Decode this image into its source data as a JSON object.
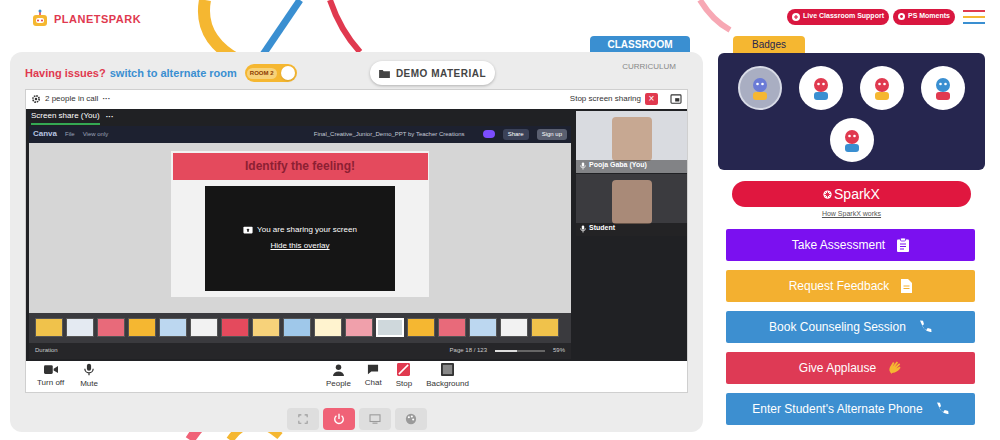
{
  "header": {
    "logo": "PLANETSPARK",
    "buttons": [
      {
        "label": "Live Classroom Support",
        "kind": "support"
      },
      {
        "label": "PS Moments",
        "kind": "moments"
      }
    ]
  },
  "room": {
    "issue": "Having issues?",
    "switch_link": "switch to alternate room",
    "toggle": {
      "label": "ROOM 2",
      "on": true
    }
  },
  "demo_material": "DEMO MATERIAL",
  "tabs": [
    {
      "label": "CLASSROOM",
      "selected": true
    },
    {
      "label": "CURRICULUM",
      "selected": false
    }
  ],
  "call": {
    "people": "2 people in call",
    "more": "···",
    "stop_sharing": "Stop screen sharing",
    "close": "×",
    "share": {
      "label": "Screen share (You)",
      "more": "···",
      "app": {
        "brand": "Canva",
        "menu": [
          "File",
          "View only"
        ],
        "title": "Final_Creative_Junior_Demo_PPT by Teacher Creations",
        "share": "Share",
        "signup": "Sign up"
      },
      "slide": {
        "title": "Identify the feeling!",
        "overlay": "You are sharing your screen",
        "hide": "Hide this overlay"
      },
      "thumbnails": [
        {
          "selected": false
        },
        {
          "selected": false
        },
        {
          "selected": false
        },
        {
          "selected": false
        },
        {
          "selected": false
        },
        {
          "selected": false
        },
        {
          "selected": false
        },
        {
          "selected": false
        },
        {
          "selected": false
        },
        {
          "selected": false
        },
        {
          "selected": false
        },
        {
          "selected": true
        },
        {
          "selected": false
        },
        {
          "selected": false
        },
        {
          "selected": false
        },
        {
          "selected": false
        },
        {
          "selected": false
        }
      ],
      "footer": {
        "duration": "Duration",
        "page": "Page 18 / 123",
        "zoom": "59%",
        "zoom_level": 0.45
      }
    },
    "participants": [
      {
        "name": "Pooja Gaba (You)"
      },
      {
        "name": "Student"
      }
    ],
    "controls": [
      {
        "label": "Turn off",
        "kind": "camera",
        "active": false
      },
      {
        "label": "Mute",
        "kind": "mic",
        "active": false
      },
      {
        "label": "People",
        "kind": "people",
        "active": false
      },
      {
        "label": "Chat",
        "kind": "chat",
        "active": false
      },
      {
        "label": "Stop",
        "kind": "stop",
        "active": true
      },
      {
        "label": "Background",
        "kind": "background",
        "active": false
      }
    ]
  },
  "tools": [
    {
      "kind": "fullscreen",
      "active": false
    },
    {
      "kind": "power",
      "active": true
    },
    {
      "kind": "screen",
      "active": false
    },
    {
      "kind": "palette",
      "active": false
    }
  ],
  "badges": {
    "title": "Badges",
    "items": [
      {
        "selected": true
      },
      {
        "selected": false
      },
      {
        "selected": false
      },
      {
        "selected": false
      },
      {
        "selected": false
      }
    ]
  },
  "sparkx": {
    "label": "SparkX",
    "link": "How SparkX works"
  },
  "actions": [
    {
      "label": "Take Assessment",
      "kind": "clipboard",
      "color": "#7b10f0"
    },
    {
      "label": "Request Feedback",
      "kind": "document",
      "color": "#f3b030"
    },
    {
      "label": "Book Counseling Session",
      "kind": "phone",
      "color": "#3d8fd0"
    },
    {
      "label": "Give Applause",
      "kind": "clap",
      "color": "#de3a55"
    },
    {
      "label": "Enter Student's Alternate Phone",
      "kind": "phone",
      "color": "#3d8fd0"
    }
  ]
}
